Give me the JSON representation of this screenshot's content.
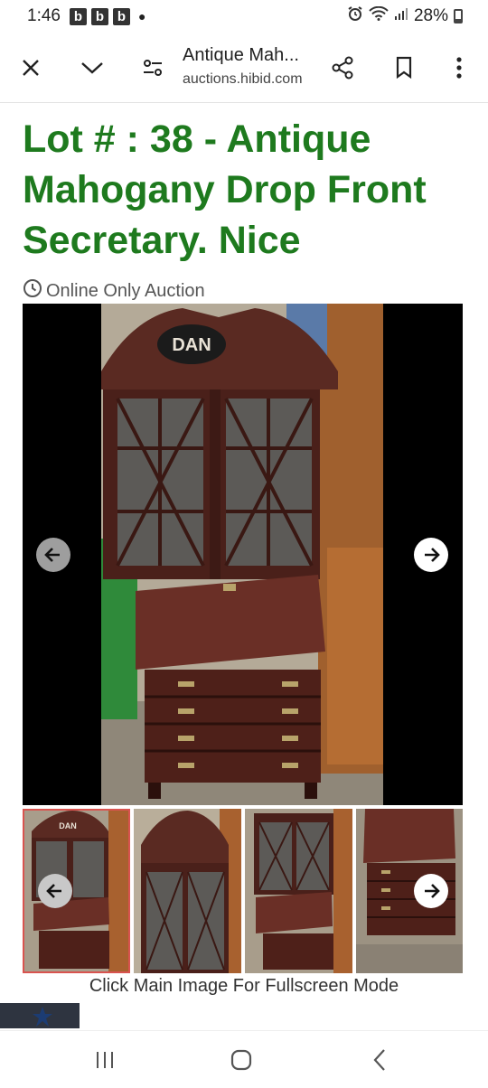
{
  "status_bar": {
    "time": "1:46",
    "notification_badges": [
      "b",
      "b",
      "b"
    ],
    "battery": "28%"
  },
  "toolbar": {
    "page_title": "Antique Mah...",
    "host": "auctions.hibid.com",
    "icons": [
      "close-icon",
      "chevron-down-icon",
      "page-settings-icon",
      "share-icon",
      "bookmark-icon",
      "more-icon"
    ]
  },
  "lot": {
    "title": "Lot # : 38 - Antique Mahogany Drop Front Secretary. Nice",
    "auction_type": "Online Only Auction"
  },
  "gallery": {
    "sign_text": "DAN",
    "thumbnail_sign_text": "DAN",
    "thumbnails": [
      "front",
      "top-glass",
      "full-closed",
      "drawers"
    ],
    "selected_index": 0,
    "hint": "Click Main Image For Fullscreen Mode"
  },
  "colors": {
    "title_green": "#1e7a1e",
    "selected_thumb_border": "#d9534f"
  }
}
